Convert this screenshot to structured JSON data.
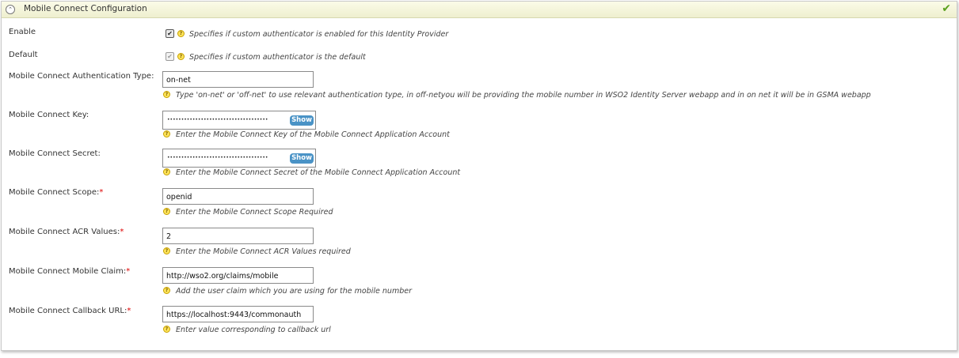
{
  "panel": {
    "title": "Mobile Connect Configuration",
    "collapse_icon": "collapse-circle-icon",
    "status_icon": "check-icon",
    "status_color": "#5aa11d"
  },
  "fields": {
    "enable": {
      "label": "Enable",
      "checked": true,
      "hint": "Specifies if custom authenticator is enabled for this Identity Provider"
    },
    "default": {
      "label": "Default",
      "checked": true,
      "disabled": true,
      "hint": "Specifies if custom authenticator is the default"
    },
    "auth_type": {
      "label": "Mobile Connect Authentication Type:",
      "value": "on-net",
      "hint": "Type 'on-net' or 'off-net' to use relevant authentication type, in off-netyou will be providing the mobile number in WSO2 Identity Server webapp and in on net it will be in GSMA webapp"
    },
    "key": {
      "label": "Mobile Connect Key:",
      "masked": "••••••••••••••••••••••••••••••••••••",
      "show_label": "Show",
      "hint": "Enter the Mobile Connect Key of the Mobile Connect Application Account"
    },
    "secret": {
      "label": "Mobile Connect Secret:",
      "masked": "••••••••••••••••••••••••••••••••••••",
      "show_label": "Show",
      "hint": "Enter the Mobile Connect Secret of the Mobile Connect Application Account"
    },
    "scope": {
      "label": "Mobile Connect Scope:",
      "required_mark": "*",
      "value": "openid",
      "hint": "Enter the Mobile Connect Scope Required"
    },
    "acr": {
      "label": "Mobile Connect ACR Values:",
      "required_mark": "*",
      "value": "2",
      "hint": "Enter the Mobile Connect ACR Values required"
    },
    "mobile_claim": {
      "label": "Mobile Connect Mobile Claim:",
      "required_mark": "*",
      "value": "http://wso2.org/claims/mobile",
      "hint": "Add the user claim which you are using for the mobile number"
    },
    "callback": {
      "label": "Mobile Connect Callback URL:",
      "required_mark": "*",
      "value": "https://localhost:9443/commonauth",
      "hint": "Enter value corresponding to callback url"
    }
  },
  "checkbox_glyph": "✔",
  "help_glyph": "?"
}
